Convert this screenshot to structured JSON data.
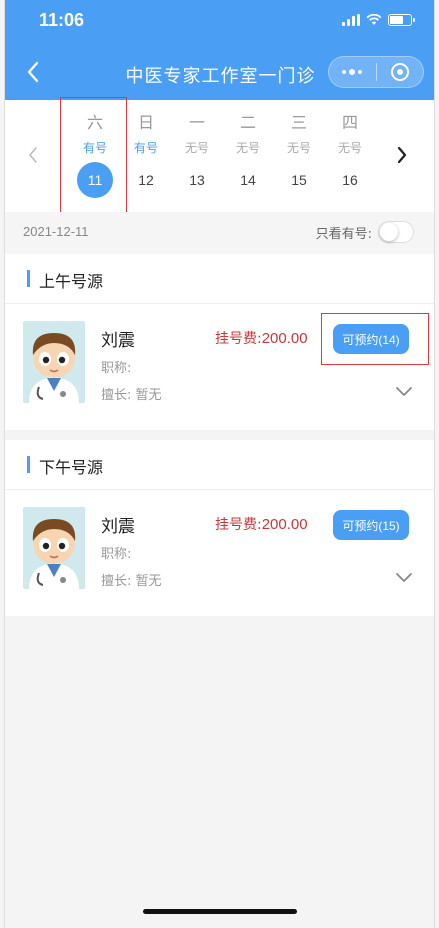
{
  "status_bar": {
    "time": "11:06"
  },
  "nav": {
    "title": "中医专家工作室一门诊"
  },
  "calendar": {
    "days": [
      {
        "weekday": "六",
        "availability": "有号",
        "date": "11",
        "has_slots": true,
        "selected": true
      },
      {
        "weekday": "日",
        "availability": "有号",
        "date": "12",
        "has_slots": true,
        "selected": false
      },
      {
        "weekday": "一",
        "availability": "无号",
        "date": "13",
        "has_slots": false,
        "selected": false
      },
      {
        "weekday": "二",
        "availability": "无号",
        "date": "14",
        "has_slots": false,
        "selected": false
      },
      {
        "weekday": "三",
        "availability": "无号",
        "date": "15",
        "has_slots": false,
        "selected": false
      },
      {
        "weekday": "四",
        "availability": "无号",
        "date": "16",
        "has_slots": false,
        "selected": false
      }
    ]
  },
  "filter": {
    "date": "2021-12-11",
    "only_available_label": "只看有号:",
    "only_available_on": false
  },
  "sections": [
    {
      "title": "上午号源",
      "doctor": {
        "name": "刘震",
        "title_label": "职称:",
        "specialty": "擅长: 暂无",
        "fee_label": "挂号费:",
        "fee": "200.00",
        "book_label": "可预约(14)"
      }
    },
    {
      "title": "下午号源",
      "doctor": {
        "name": "刘震",
        "title_label": "职称:",
        "specialty": "擅长: 暂无",
        "fee_label": "挂号费:",
        "fee": "200.00",
        "book_label": "可预约(15)"
      }
    }
  ],
  "colors": {
    "primary": "#4a9ef3",
    "fee": "#c9383a",
    "highlight": "#e23b3b"
  }
}
